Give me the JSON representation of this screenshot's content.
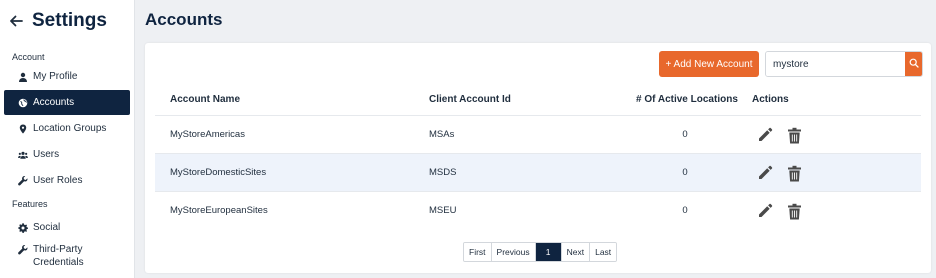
{
  "sidebar": {
    "title": "Settings",
    "sections": [
      {
        "label": "Account"
      },
      {
        "label": "Features"
      }
    ],
    "items": [
      {
        "label": "My Profile",
        "icon": "user-icon"
      },
      {
        "label": "Accounts",
        "icon": "globe-icon",
        "active": true
      },
      {
        "label": "Location Groups",
        "icon": "map-pin-icon"
      },
      {
        "label": "Users",
        "icon": "users-icon"
      },
      {
        "label": "User Roles",
        "icon": "wrench-icon"
      },
      {
        "label": "Social",
        "icon": "gear-icon"
      },
      {
        "label": "Third-Party Credentials",
        "icon": "wrench-icon"
      }
    ]
  },
  "page": {
    "title": "Accounts"
  },
  "toolbar": {
    "add_label": "+ Add New Account",
    "search_value": "mystore",
    "search_icon": "search-icon"
  },
  "table": {
    "headers": [
      "Account Name",
      "Client Account Id",
      "# Of Active Locations",
      "Actions"
    ],
    "rows": [
      {
        "name": "MyStoreAmericas",
        "client_id": "MSAs",
        "locations": "0"
      },
      {
        "name": "MyStoreDomesticSites",
        "client_id": "MSDS",
        "locations": "0"
      },
      {
        "name": "MyStoreEuropeanSites",
        "client_id": "MSEU",
        "locations": "0"
      }
    ]
  },
  "pagination": {
    "first": "First",
    "previous": "Previous",
    "current": "1",
    "next": "Next",
    "last": "Last"
  },
  "colors": {
    "navy": "#0f2440",
    "accent": "#e8682c",
    "row_highlight": "#eef3fb"
  }
}
